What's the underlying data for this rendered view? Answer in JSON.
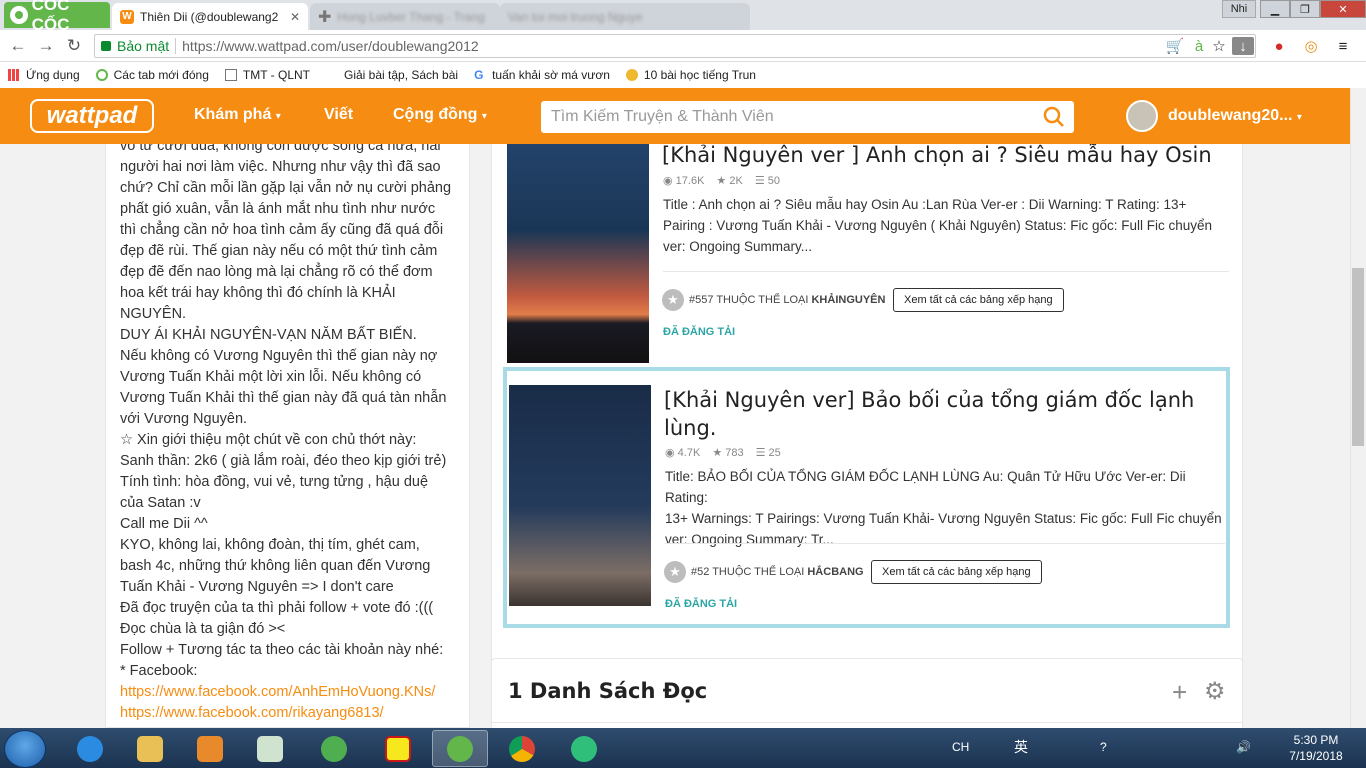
{
  "browser": {
    "brand": "CỐC CỐC",
    "tabs": [
      {
        "label": "Thiên Dii (@doublewang2",
        "active": true
      },
      {
        "label": "Hong Luvber Thang - Trang",
        "active": false
      },
      {
        "label": "Van toi moi truong Nguye",
        "active": false
      }
    ],
    "user_chip": "Nhi",
    "secure_label": "Bảo mật",
    "url": "https://www.wattpad.com/user/doublewang2012",
    "bookmarks": [
      {
        "label": "Ứng dụng",
        "icon": "apps-icon"
      },
      {
        "label": "Các tab mới đóng",
        "icon": "history-icon"
      },
      {
        "label": "TMT - QLNT",
        "icon": "page-icon"
      },
      {
        "label": "Giải bài tập, Sách bài",
        "icon": "site-icon"
      },
      {
        "label": "tuấn khải sờ má vươn",
        "icon": "google-icon"
      },
      {
        "label": "10 bài học tiếng Trun",
        "icon": "bulb-icon"
      }
    ]
  },
  "header": {
    "logo": "wattpad",
    "nav": [
      "Khám phá",
      "Viết",
      "Cộng đồng"
    ],
    "search_placeholder": "Tìm Kiếm Truyện & Thành Viên",
    "username": "doublewang20..."
  },
  "bio_lines": [
    "vô tư cười đùa, không còn được sống cả nửa, hai",
    "người hai nơi làm việc. Nhưng như vậy thì đã sao",
    "chứ? Chỉ cần mỗi lần gặp lại vẫn nở nụ cười phảng",
    "phất gió xuân, vẫn là ánh mắt nhu tình như nước",
    "thì chẳng cần nở hoa tình cảm ấy cũng đã quá đỗi",
    "đẹp đẽ rùi. Thế gian này nếu có một thứ tình cảm",
    "đẹp đẽ đến nao lòng mà lại chẳng rõ có thể đơm",
    "hoa kết trái hay không thì đó chính là KHẢI",
    "NGUYÊN.",
    "DUY ÁI KHẢI NGUYÊN-VẠN NĂM BẤT BIẾN.",
    "Nếu không có Vương Nguyên thì thế gian này nợ",
    "Vương Tuấn Khải một lời xin lỗi. Nếu không có",
    "Vương Tuấn Khải thì thế gian này đã quá tàn nhẫn",
    "với Vương Nguyên.",
    "☆ Xin giới thiệu một chút về con chủ thớt này:",
    "Sanh thần: 2k6 ( già lắm roài, đéo theo kịp giới trẻ)",
    "Tính tình: hòa đồng, vui vẻ, tưng tửng , hậu duệ",
    "của Satan :v",
    "Call me Dii ^^",
    "KYO, không lai, không đoàn, thị tím, ghét cam,",
    "bash 4c, những thứ không liên quan đến Vương",
    "Tuấn Khải - Vương Nguyên => I don't care",
    "Đã đọc truyện của ta thì phải follow + vote đó :(((",
    "Đọc chùa là ta giận đó ><",
    "Follow + Tương tác ta theo các tài khoản này nhé:",
    "* Facebook:"
  ],
  "bio_links": [
    "https://www.facebook.com/AnhEmHoVuong.KNs/",
    "https://www.facebook.com/rikayang6813/"
  ],
  "stories": [
    {
      "title": "[Khải Nguyên ver ] Anh chọn ai ? Siêu mẫu hay Osin",
      "reads": "17.6K",
      "votes": "2K",
      "parts": "50",
      "desc_lines": [
        "Title : Anh chọn ai ? Siêu mẫu hay Osin Au :Lan Rùa Ver-er : Dii Warning: T Rating: 13+",
        "Pairing : Vương Tuấn Khải - Vương Nguyên ( Khải Nguyên) Status: Fic gốc: Full Fic chuyển",
        "ver: Ongoing Summary..."
      ],
      "rank_prefix": "#557 THUỘC THỂ LOẠI ",
      "rank_tag": "KHẢINGUYÊN",
      "rank_button": "Xem tất cả các bảng xếp hạng",
      "status": "ĐÃ ĐĂNG TẢI"
    },
    {
      "title_lines": [
        "[Khải Nguyên ver] Bảo bối của tổng giám đốc lạnh",
        "lùng."
      ],
      "reads": "4.7K",
      "votes": "783",
      "parts": "25",
      "desc_lines": [
        "Title: BẢO BỐI CỦA TỔNG GIÁM ĐỐC LẠNH LÙNG Au: Quân Tử Hữu Ước Ver-er: Dii Rating:",
        "13+ Warnings: T Pairings: Vương Tuấn Khải- Vương Nguyên Status: Fic gốc: Full Fic chuyển",
        "ver: Ongoing Summary: Tr..."
      ],
      "rank_prefix": "#52 THUỘC THỂ LOẠI ",
      "rank_tag": "HẮCBANG",
      "rank_button": "Xem tất cả các bảng xếp hạng",
      "status": "ĐÃ ĐĂNG TẢI"
    }
  ],
  "reading_list": {
    "title": "1 Danh Sách Đọc"
  },
  "taskbar": {
    "lang": "CH",
    "ime": "英",
    "time": "5:30 PM",
    "date": "7/19/2018"
  },
  "colors": {
    "brand_orange": "#f68d12",
    "highlight": "#a9dbe7",
    "published": "#2da5a5"
  }
}
